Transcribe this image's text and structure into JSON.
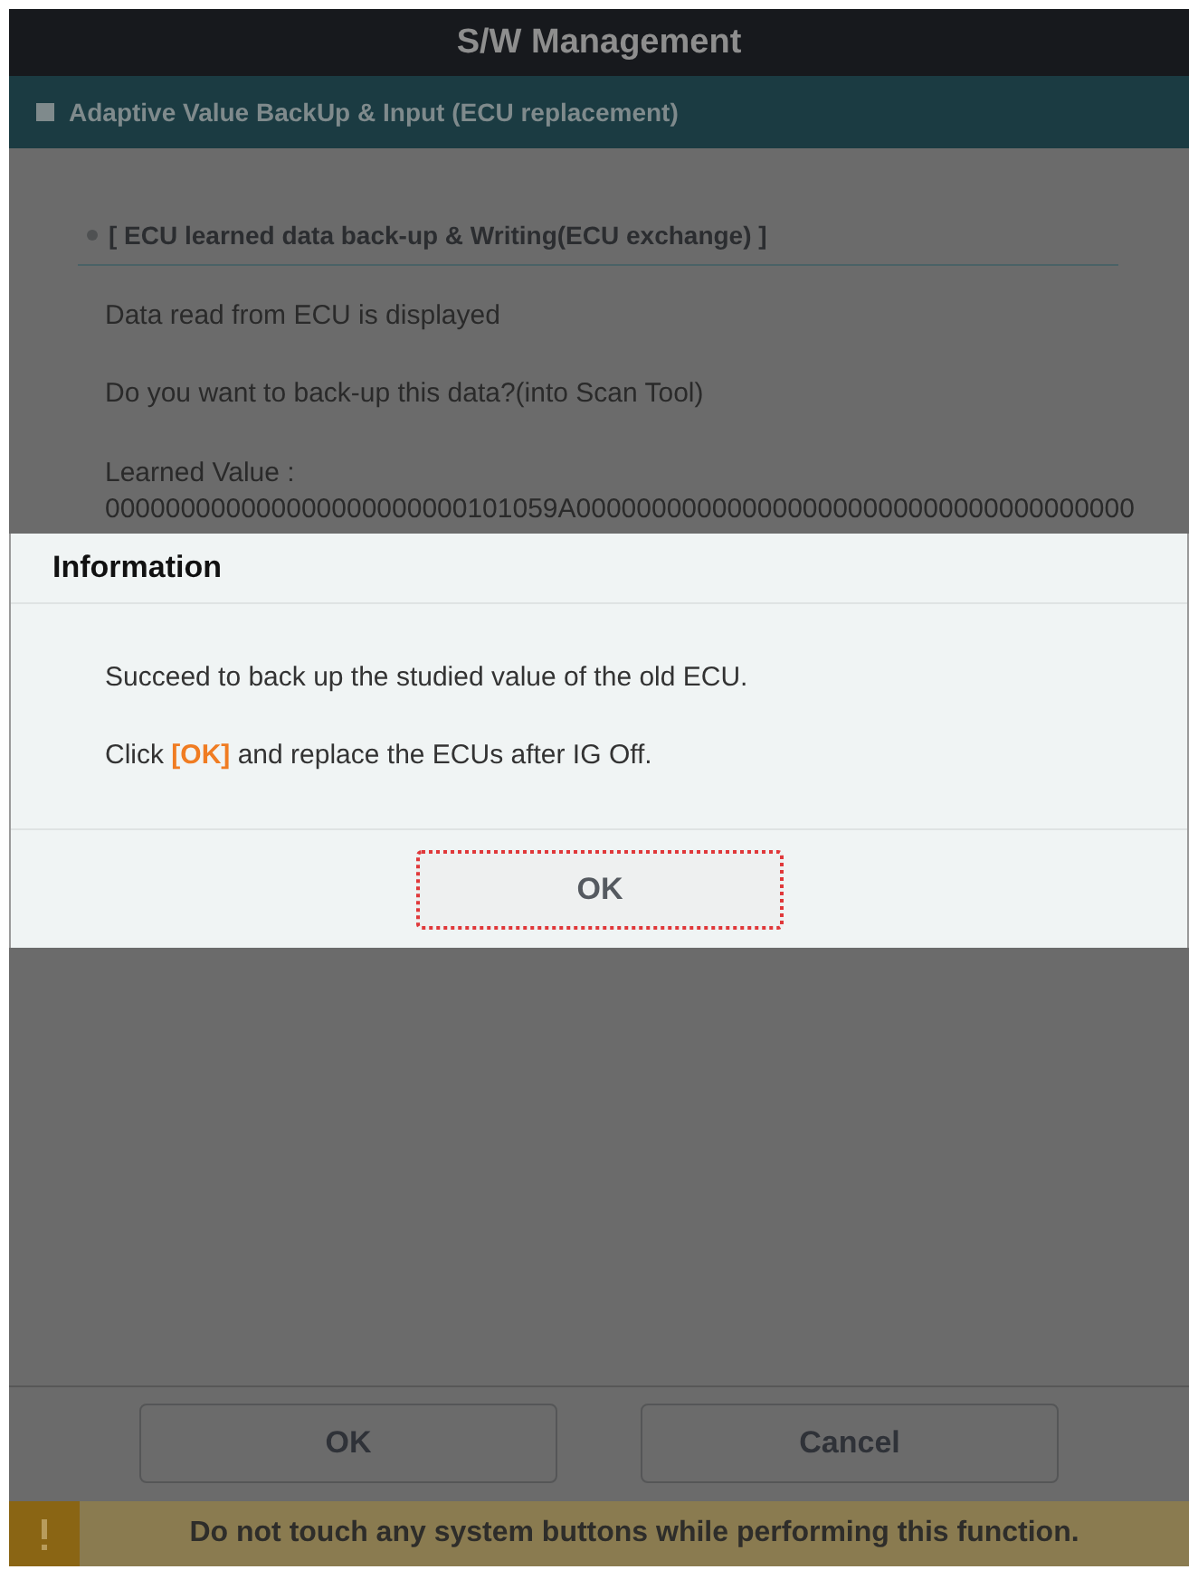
{
  "window": {
    "title": "S/W Management"
  },
  "section": {
    "title": "Adaptive Value BackUp & Input (ECU replacement)"
  },
  "content": {
    "heading": "[ ECU learned data back-up & Writing(ECU exchange) ]",
    "paragraphs": [
      "Data read from ECU is displayed",
      "Do you want to back-up this data?(into Scan Tool)"
    ],
    "learned_value": {
      "label": "Learned Value :",
      "value": "000000000000000000000000101059A0000000000000000000000000000000000000"
    }
  },
  "dialog": {
    "title": "Information",
    "messages": [
      "Succeed to back up the studied value of the old ECU.",
      "Click **[OK]** and replace the ECUs after IG Off."
    ],
    "button": {
      "label": "OK",
      "focused": true
    }
  },
  "buttons": [
    {
      "label": "OK"
    },
    {
      "label": "Cancel"
    }
  ],
  "warning": {
    "text": "Do not touch any system buttons while performing this function."
  }
}
